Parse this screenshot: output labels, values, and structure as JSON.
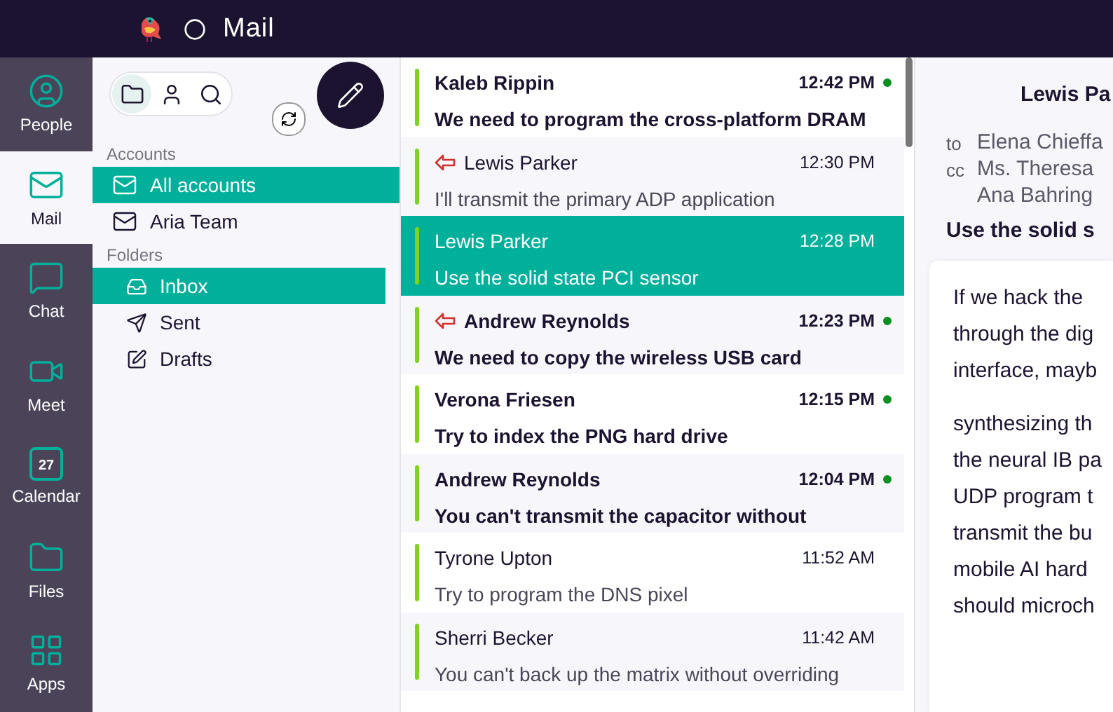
{
  "app_bar": {
    "title": "Mail"
  },
  "nav": [
    {
      "label": "People",
      "kind": "people",
      "selected": false
    },
    {
      "label": "Mail",
      "kind": "mail",
      "selected": true
    },
    {
      "label": "Chat",
      "kind": "chat",
      "selected": false
    },
    {
      "label": "Meet",
      "kind": "meet",
      "selected": false
    },
    {
      "label": "Calendar",
      "kind": "calendar",
      "badge": "27",
      "selected": false
    },
    {
      "label": "Files",
      "kind": "files",
      "selected": false
    },
    {
      "label": "Apps",
      "kind": "apps",
      "selected": false
    }
  ],
  "view_switch": [
    {
      "kind": "folder",
      "selected": true
    },
    {
      "kind": "person",
      "selected": false
    },
    {
      "kind": "search",
      "selected": false
    }
  ],
  "accounts": {
    "heading": "Accounts",
    "items": [
      {
        "label": "All accounts",
        "selected": true
      },
      {
        "label": "Aria Team",
        "selected": false
      }
    ]
  },
  "folders": {
    "heading": "Folders",
    "items": [
      {
        "label": "Inbox",
        "kind": "inbox",
        "selected": true
      },
      {
        "label": "Sent",
        "kind": "sent",
        "selected": false
      },
      {
        "label": "Drafts",
        "kind": "drafts",
        "selected": false
      }
    ]
  },
  "messages": [
    {
      "sender": "Kaleb Rippin",
      "time": "12:42 PM",
      "subject": "We need to program the cross-platform DRAM",
      "unread": true,
      "replied": false,
      "selected": false
    },
    {
      "sender": "Lewis Parker",
      "time": "12:30 PM",
      "subject": "I'll transmit the primary ADP application",
      "unread": false,
      "replied": true,
      "selected": false
    },
    {
      "sender": "Lewis Parker",
      "time": "12:28 PM",
      "subject": "Use the solid state PCI sensor",
      "unread": false,
      "replied": false,
      "selected": true
    },
    {
      "sender": "Andrew Reynolds",
      "time": "12:23 PM",
      "subject": "We need to copy the wireless USB card",
      "unread": true,
      "replied": true,
      "selected": false
    },
    {
      "sender": "Verona Friesen",
      "time": "12:15 PM",
      "subject": "Try to index the PNG hard drive",
      "unread": true,
      "replied": false,
      "selected": false
    },
    {
      "sender": "Andrew Reynolds",
      "time": "12:04 PM",
      "subject": "You can't transmit the capacitor without",
      "unread": true,
      "replied": false,
      "selected": false
    },
    {
      "sender": "Tyrone Upton",
      "time": "11:52 AM",
      "subject": "Try to program the DNS pixel",
      "unread": false,
      "replied": false,
      "selected": false
    },
    {
      "sender": "Sherri Becker",
      "time": "11:42 AM",
      "subject": "You can't back up the matrix without overriding",
      "unread": false,
      "replied": false,
      "selected": false
    }
  ],
  "reader": {
    "sender": "Lewis Pa",
    "to_label": "to",
    "to": "Elena Chieffa",
    "cc_label": "cc",
    "cc": [
      "Ms. Theresa",
      "Ana Bahring"
    ],
    "subject": "Use the solid s",
    "paragraphs": [
      [
        "If we hack the",
        "through the dig",
        "interface, mayb"
      ],
      [
        "synthesizing th",
        "the neural IB pa",
        "UDP program t",
        "transmit the bu",
        "mobile AI hard",
        "should microch"
      ]
    ]
  }
}
